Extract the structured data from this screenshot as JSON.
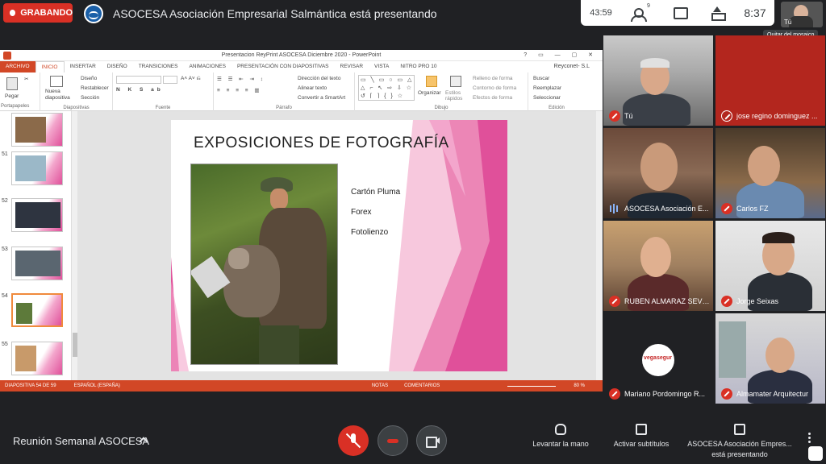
{
  "topbar": {
    "recording_label": "GRABANDO",
    "presenting_title": "ASOCESA Asociación Empresarial Salmántica está presentando",
    "elapsed": "43:59",
    "people_count": "9",
    "clock": "8:37",
    "self_label": "Tú",
    "tooltip": "Quitar del mosaico"
  },
  "ppt": {
    "window_title": "Presentacion ReyPrint ASOCESA Diciembre 2020 - PowerPoint",
    "user": "Reyconet- S.L",
    "tabs": [
      "ARCHIVO",
      "INICIO",
      "INSERTAR",
      "DISEÑO",
      "TRANSICIONES",
      "ANIMACIONES",
      "PRESENTACIÓN CON DIAPOSITIVAS",
      "REVISAR",
      "VISTA",
      "NITRO PRO 10"
    ],
    "ribbon": {
      "paste": "Pegar",
      "clipboard_group": "Portapapeles",
      "new_slide": "Nueva diapositiva",
      "layout": "Diseño",
      "reset": "Restablecer",
      "section": "Sección",
      "slides_group": "Diapositivas",
      "font_group": "Fuente",
      "text_direction": "Dirección del texto",
      "align_text": "Alinear texto",
      "convert_smartart": "Convertir a SmartArt",
      "paragraph_group": "Párrafo",
      "arrange": "Organizar",
      "quick_styles": "Estilos rápidos",
      "shape_fill": "Relleno de forma",
      "shape_outline": "Contorno de forma",
      "shape_effects": "Efectos de forma",
      "drawing_group": "Dibujo",
      "find": "Buscar",
      "replace": "Reemplazar",
      "select": "Seleccionar",
      "editing_group": "Edición"
    },
    "thumbnails": [
      {
        "num": ""
      },
      {
        "num": "51"
      },
      {
        "num": "52"
      },
      {
        "num": "53"
      },
      {
        "num": "54"
      },
      {
        "num": "55"
      }
    ],
    "slide": {
      "title": "EXPOSICIONES DE FOTOGRAFÍA",
      "items": [
        "Cartón Pluma",
        "Forex",
        "Fotolienzo"
      ]
    },
    "status": {
      "slide_pos": "DIAPOSITIVA 54 DE 59",
      "language": "ESPAÑOL (ESPAÑA)",
      "notes": "NOTAS",
      "comments": "COMENTARIOS",
      "zoom": "80 %"
    }
  },
  "participants": [
    {
      "name": "Tú",
      "muted": true
    },
    {
      "name": "jose regino dominguez ...",
      "muted": true
    },
    {
      "name": "ASOCESA Asociación E...",
      "muted": false
    },
    {
      "name": "Carlos FZ",
      "muted": true
    },
    {
      "name": "RUBEN ALMARAZ SEVI...",
      "muted": true
    },
    {
      "name": "Jorge Seixas",
      "muted": true
    },
    {
      "name": "Mariano Pordomingo R...",
      "muted": true
    },
    {
      "name": "Almamater Arquitectur",
      "muted": true
    }
  ],
  "vegasegur_logo": "vegasegur",
  "bottombar": {
    "meeting_name": "Reunión Semanal ASOCESA",
    "raise_hand": "Levantar la mano",
    "captions": "Activar subtítulos",
    "presenting_line1": "ASOCESA Asociación Empres...",
    "presenting_line2": "está presentando"
  },
  "colors": {
    "recording_red": "#d93025",
    "ppt_orange": "#d24726",
    "slide_pink": "#e0509a"
  }
}
